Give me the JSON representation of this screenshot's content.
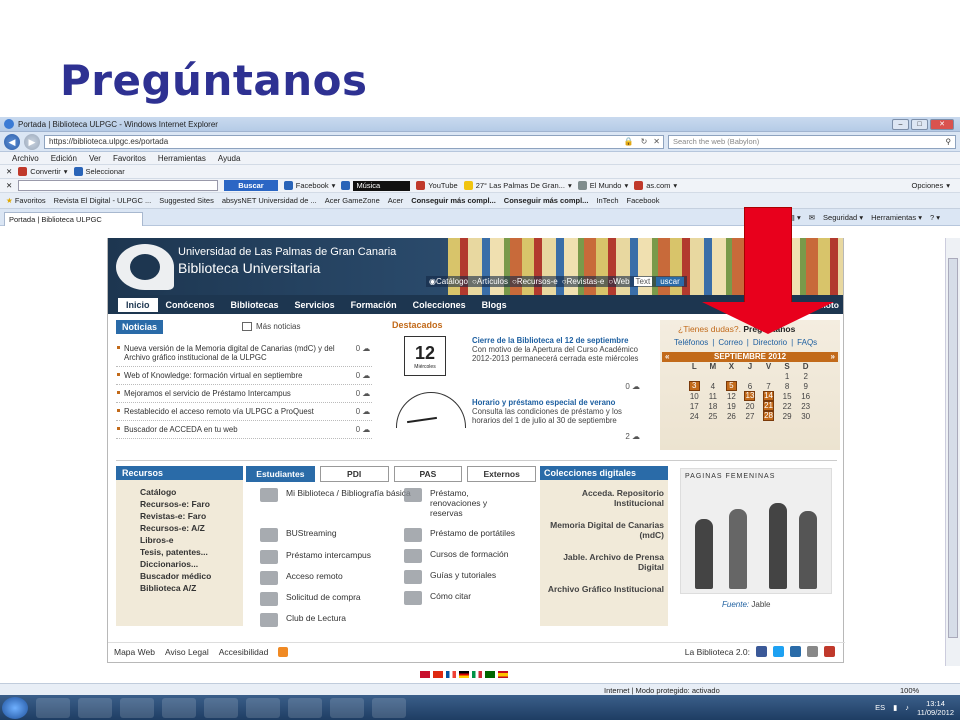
{
  "slide": {
    "title": "Pregúntanos"
  },
  "browser": {
    "window_title": "Portada | Biblioteca ULPGC - Windows Internet Explorer",
    "url": "https://biblioteca.ulpgc.es/portada",
    "search_placeholder": "Search the web (Babylon)",
    "menu": [
      "Archivo",
      "Edición",
      "Ver",
      "Favoritos",
      "Herramientas",
      "Ayuda"
    ],
    "toolbar1": {
      "convert": "Convertir",
      "select": "Seleccionar"
    },
    "toolbar2": {
      "buscar": "Buscar",
      "facebook": "Facebook",
      "musica": "Música",
      "youtube": "YouTube",
      "las_palmas": "27° Las Palmas De Gran...",
      "elmundo": "El Mundo",
      "ascom": "as.com",
      "opciones": "Opciones"
    },
    "favbar": {
      "favoritos": "Favoritos",
      "items": [
        "Revista El Digital - ULPGC ...",
        "Suggested Sites",
        "absysNET Universidad de ...",
        "Acer GameZone",
        "Acer",
        "Conseguir más compl...",
        "Conseguir más compl...",
        "InTech",
        "Facebook"
      ]
    },
    "tab": {
      "label": "Portada | Biblioteca ULPGC"
    },
    "commands": {
      "seguridad": "Seguridad",
      "herramientas": "Herramientas"
    },
    "status": {
      "zone": "Internet | Modo protegido: activado",
      "zoom": "100%"
    },
    "taskbar": {
      "lang": "ES",
      "time": "13:14",
      "date": "11/09/2012"
    }
  },
  "site": {
    "banner": {
      "university": "Universidad de Las Palmas de Gran Canaria",
      "library": "Biblioteca Universitaria"
    },
    "search_options": [
      "Catálogo",
      "Artículos",
      "Recursos-e",
      "Revistas-e",
      "Web"
    ],
    "search_text": "Text",
    "search_btn": "uscar",
    "nav": [
      "Inicio",
      "Conócenos",
      "Bibliotecas",
      "Servicios",
      "Formación",
      "Colecciones",
      "Blogs"
    ],
    "acceso_remoto": "ceso Remoto",
    "noticias": {
      "title": "Noticias",
      "more": "Más noticias",
      "items": [
        {
          "text": "Nueva versión de la Memoria digital de Canarias (mdC) y del Archivo gráfico institucional de la ULPGC",
          "count": "0"
        },
        {
          "text": "Web of Knowledge: formación virtual en septiembre",
          "count": "0"
        },
        {
          "text": "Mejoramos el servicio de Préstamo Intercampus",
          "count": "0"
        },
        {
          "text": "Restablecido el acceso remoto vía ULPGC a ProQuest",
          "count": "0"
        },
        {
          "text": "Buscador de ACCEDA en tu web",
          "count": "0"
        }
      ]
    },
    "destacados": {
      "title": "Destacados",
      "cal_num": "12",
      "cal_day": "Miércoles",
      "items": [
        {
          "title": "Cierre de la Biblioteca el 12 de septiembre",
          "body": "Con motivo de la Apertura del Curso Académico 2012-2013 permanecerá cerrada este miércoles",
          "count": "0"
        },
        {
          "title": "Horario y préstamo especial de verano",
          "body": "Consulta las condiciones de préstamo y los horarios del 1 de julio al 30 de septiembre",
          "count": "2"
        }
      ]
    },
    "dudas": {
      "question": "¿Tienes dudas?.",
      "preguntanos": "Pregúntanos",
      "links": [
        "Teléfonos",
        "Correo",
        "Directorio",
        "FAQs"
      ]
    },
    "calendar": {
      "month": "SEPTIEMBRE 2012",
      "prev": "«",
      "next": "»",
      "weekdays": [
        "L",
        "M",
        "X",
        "J",
        "V",
        "S",
        "D"
      ],
      "weeks": [
        [
          "",
          "",
          "",
          "",
          "",
          "1",
          "2"
        ],
        [
          "3",
          "4",
          "5",
          "6",
          "7",
          "8",
          "9"
        ],
        [
          "10",
          "11",
          "12",
          "13",
          "14",
          "15",
          "16"
        ],
        [
          "17",
          "18",
          "19",
          "20",
          "21",
          "22",
          "23"
        ],
        [
          "24",
          "25",
          "26",
          "27",
          "28",
          "29",
          "30"
        ]
      ],
      "highlighted": [
        "3",
        "5",
        "13",
        "14",
        "21",
        "28"
      ]
    },
    "recursos": {
      "title": "Recursos",
      "items": [
        "Catálogo",
        "Recursos-e: Faro",
        "Revistas-e: Faro",
        "Recursos-e: A/Z",
        "Libros-e",
        "Tesis, patentes...",
        "Diccionarios...",
        "Buscador médico",
        "Biblioteca A/Z"
      ]
    },
    "tabs": [
      "Estudiantes",
      "PDI",
      "PAS",
      "Externos"
    ],
    "services": {
      "left": [
        "Mi Biblioteca / Bibliografía básica",
        "BUStreaming",
        "Préstamo intercampus",
        "Acceso remoto",
        "Solicitud de compra",
        "Club de Lectura"
      ],
      "right": [
        "Préstamo, renovaciones y reservas",
        "Préstamo de portátiles",
        "Cursos de formación",
        "Guías y tutoriales",
        "Cómo citar"
      ]
    },
    "colecciones": {
      "title": "Colecciones digitales",
      "items": [
        "Acceda. Repositorio Institucional",
        "Memoria Digital de Canarias (mdC)",
        "Jable. Archivo de Prensa Digital",
        "Archivo Gráfico Institucional"
      ]
    },
    "ad": {
      "header": "PAGINAS FEMENINAS",
      "fuente_label": "Fuente:",
      "fuente": "Jable"
    },
    "footer": {
      "links": [
        "Mapa Web",
        "Aviso Legal",
        "Accesibilidad"
      ],
      "b20": "La Biblioteca 2.0:"
    }
  }
}
